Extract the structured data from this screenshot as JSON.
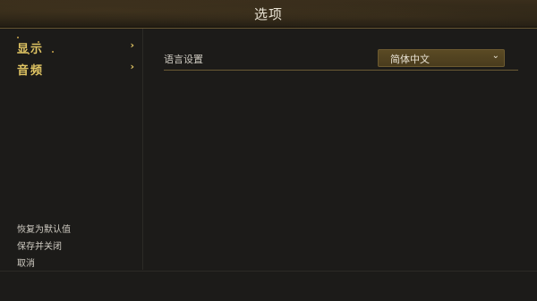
{
  "window": {
    "title": "选项"
  },
  "sidebar": {
    "items": [
      {
        "label": "显示",
        "chevron": "›",
        "active": true
      },
      {
        "label": "音频",
        "chevron": "›",
        "active": false
      }
    ],
    "footer": [
      {
        "label": "恢复为默认值"
      },
      {
        "label": "保存并关闭"
      },
      {
        "label": "取消"
      }
    ]
  },
  "settings": {
    "language": {
      "label": "语言设置",
      "value": "简体中文",
      "arrow": "⌄"
    }
  },
  "colors": {
    "accent_gold": "#e0c463",
    "dropdown_bg": "#5a4a24",
    "panel_bg": "#1c1b19",
    "divider": "#6a5a34"
  }
}
